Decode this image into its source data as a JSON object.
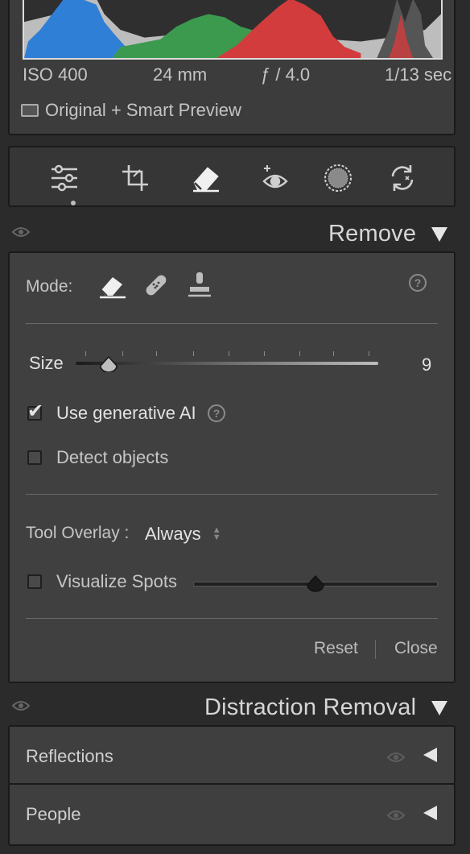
{
  "histogram": {
    "colors": {
      "blue": "#2f7fd6",
      "green": "#3c9a4f",
      "red": "#d23c3c",
      "gray": "#bdbdbd"
    }
  },
  "exif": {
    "iso": "ISO 400",
    "focal": "24 mm",
    "aperture": "ƒ / 4.0",
    "shutter": "1/13 sec"
  },
  "preview_status": "Original + Smart Preview",
  "toolbar": {
    "tools": [
      "edit-sliders-icon",
      "crop-icon",
      "remove-eraser-icon",
      "red-eye-icon",
      "masking-icon",
      "presets-sync-icon"
    ],
    "active_tool": "edit-sliders-icon"
  },
  "remove_section": {
    "title": "Remove",
    "mode_label": "Mode:",
    "modes": [
      "eraser-mode-icon",
      "heal-mode-icon",
      "clone-mode-icon"
    ],
    "help": "?",
    "size_label": "Size",
    "size_value": "9",
    "size_fraction": 0.11,
    "use_gen_ai_label": "Use generative AI",
    "use_gen_ai_checked": true,
    "detect_objects_label": "Detect objects",
    "detect_objects_checked": false,
    "tool_overlay_label": "Tool Overlay :",
    "tool_overlay_value": "Always",
    "visualize_spots_label": "Visualize Spots",
    "visualize_spots_checked": false,
    "visualize_fraction": 0.5,
    "reset_label": "Reset",
    "close_label": "Close"
  },
  "distraction_section": {
    "title": "Distraction Removal",
    "items": [
      {
        "label": "Reflections"
      },
      {
        "label": "People"
      }
    ]
  }
}
